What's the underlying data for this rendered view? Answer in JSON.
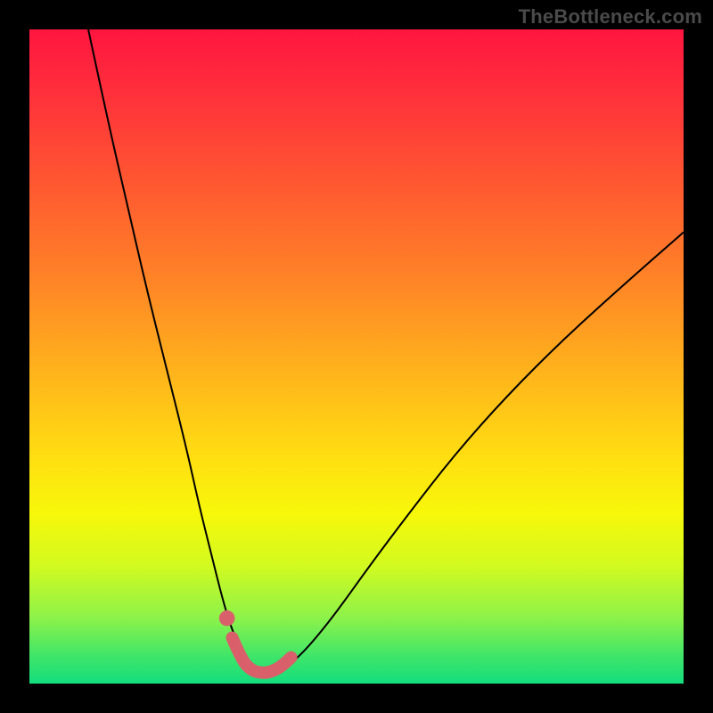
{
  "watermark": "TheBottleneck.com",
  "chart_data": {
    "type": "line",
    "title": "",
    "xlabel": "",
    "ylabel": "",
    "xlim": [
      0,
      100
    ],
    "ylim": [
      0,
      100
    ],
    "gradient_stops": [
      {
        "pos": 0,
        "color": "#ff153f"
      },
      {
        "pos": 8,
        "color": "#ff2b3c"
      },
      {
        "pos": 22,
        "color": "#ff5332"
      },
      {
        "pos": 38,
        "color": "#ff8327"
      },
      {
        "pos": 52,
        "color": "#ffb21c"
      },
      {
        "pos": 66,
        "color": "#ffe011"
      },
      {
        "pos": 74,
        "color": "#f7f80a"
      },
      {
        "pos": 82,
        "color": "#d2fa20"
      },
      {
        "pos": 90,
        "color": "#8cf24a"
      },
      {
        "pos": 96,
        "color": "#3de56a"
      },
      {
        "pos": 100,
        "color": "#14dd7d"
      }
    ],
    "series": [
      {
        "name": "bottleneck-curve",
        "stroke": "#000000",
        "stroke_width": 2,
        "x": [
          9,
          12,
          15,
          18,
          21,
          24,
          26,
          28,
          29.5,
          31,
          33,
          34.5,
          36,
          38,
          40,
          43,
          47,
          52,
          58,
          65,
          73,
          82,
          92,
          100
        ],
        "y": [
          100,
          86,
          73,
          60,
          48,
          36,
          27,
          19,
          13,
          8,
          4,
          2,
          1,
          1.5,
          3,
          6,
          11,
          18,
          26,
          35,
          44,
          53,
          62,
          69
        ]
      },
      {
        "name": "highlight-segment",
        "stroke": "#d9606a",
        "stroke_width": 14,
        "linecap": "round",
        "x": [
          31,
          32.5,
          34,
          35.5,
          37,
          38.5,
          40
        ],
        "y": [
          7,
          3.5,
          2,
          1.6,
          1.8,
          2.6,
          4
        ]
      }
    ],
    "marker": {
      "name": "highlight-dot",
      "fill": "#d9606a",
      "cx": 30.2,
      "cy": 10,
      "r": 1.2
    }
  }
}
